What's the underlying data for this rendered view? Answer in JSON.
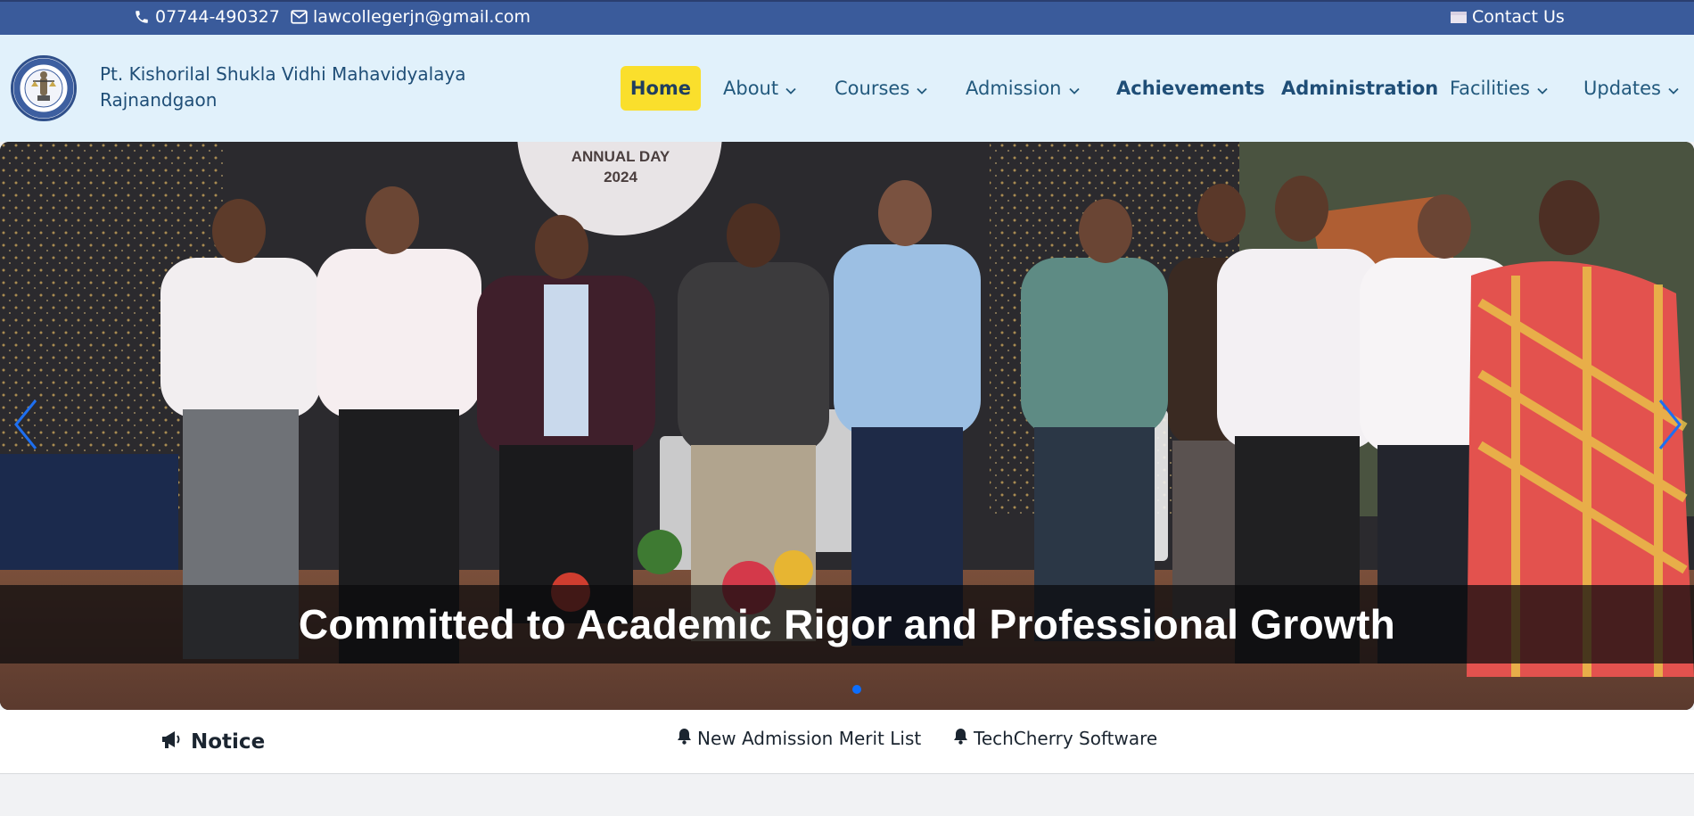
{
  "topbar": {
    "phone": "07744-490327",
    "email": "lawcollegerjn@gmail.com",
    "contact_label": "Contact Us"
  },
  "brand": {
    "line1": "Pt. Kishorilal Shukla Vidhi Mahavidyalaya",
    "line2": "Rajnandgaon"
  },
  "nav": {
    "items": [
      {
        "label": "Home",
        "active": true
      },
      {
        "label": "About",
        "dropdown": true
      },
      {
        "label": "Courses",
        "dropdown": true
      },
      {
        "label": "Admission",
        "dropdown": true
      },
      {
        "label": "Achievements"
      },
      {
        "label": "Administration"
      },
      {
        "label": "Facilities",
        "dropdown": true
      },
      {
        "label": "Updates",
        "dropdown": true
      }
    ]
  },
  "hero": {
    "banner_text_line1": "ANNUAL DAY",
    "banner_text_line2": "2024",
    "caption": "Committed to Academic Rigor and Professional Growth",
    "slide_count": 1,
    "active_slide": 1
  },
  "notice": {
    "title": "Notice",
    "items": [
      "New Admission Merit List",
      "TechCherry Software"
    ]
  },
  "colors": {
    "topbar": "#3a5b9b",
    "nav_bg": "#e1f1fb",
    "active_nav": "#fadf2c",
    "indicator": "#0d6efd",
    "arrow": "#1e6ff0"
  },
  "icons": {
    "phone": "phone-icon",
    "email": "envelope-icon",
    "contact": "flag-icon",
    "dropdown": "chevron-down-icon",
    "notice": "megaphone-icon",
    "ticker": "bell-icon",
    "prev": "chevron-left-icon",
    "next": "chevron-right-icon"
  }
}
